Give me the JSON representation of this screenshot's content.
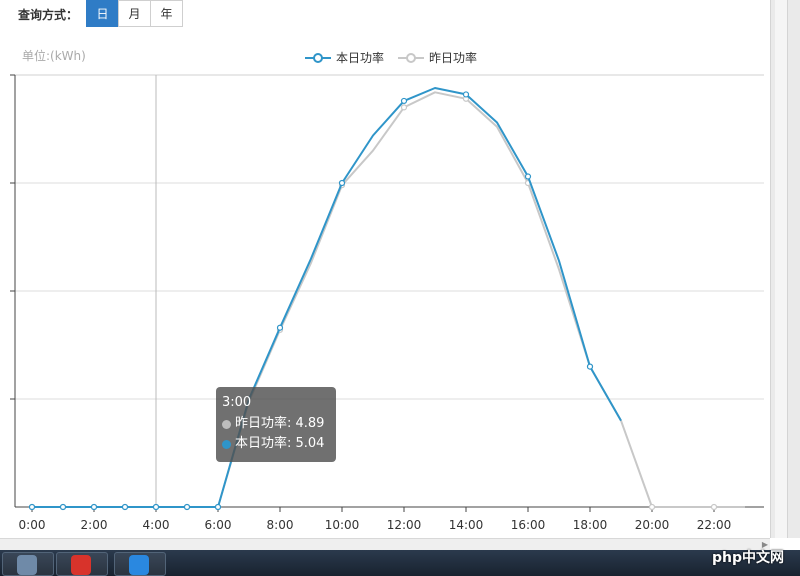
{
  "toolbar": {
    "query_label": "查询方式：",
    "buttons": [
      "日",
      "月",
      "年"
    ],
    "active": "日"
  },
  "chart_data": {
    "type": "line",
    "unit_label": "单位:(kWh)",
    "x_ticks": [
      "0:00",
      "2:00",
      "4:00",
      "6:00",
      "8:00",
      "10:00",
      "12:00",
      "14:00",
      "16:00",
      "18:00",
      "20:00",
      "22:00"
    ],
    "x": [
      0,
      1,
      2,
      3,
      4,
      5,
      6,
      7,
      8,
      9,
      10,
      11,
      12,
      13,
      14,
      15,
      16,
      17,
      18,
      19,
      20,
      21,
      22,
      23
    ],
    "ylim": [
      0,
      20
    ],
    "y_gridlines": [
      5,
      10,
      15
    ],
    "series": [
      {
        "name": "本日功率",
        "color": "#2f95c9",
        "values": [
          0,
          0,
          0,
          0,
          0,
          0,
          0,
          5,
          8.3,
          11.5,
          15,
          17.2,
          18.8,
          19.4,
          19.1,
          17.8,
          15.3,
          11.4,
          6.5,
          4.0,
          null,
          null,
          null,
          null
        ]
      },
      {
        "name": "昨日功率",
        "color": "#c8c8c8",
        "values": [
          0,
          0,
          0,
          0,
          0,
          0,
          0,
          4.89,
          8.2,
          11.3,
          14.9,
          16.5,
          18.5,
          19.2,
          18.9,
          17.6,
          15.0,
          11.0,
          6.5,
          4.0,
          0,
          0,
          0,
          0
        ]
      }
    ],
    "tooltip": {
      "title": "3:00",
      "rows": [
        {
          "label": "昨日功率: 4.89",
          "color": "#bdbdbd"
        },
        {
          "label": "本日功率: 5.04",
          "color": "#2f95c9"
        }
      ]
    }
  },
  "taskbar": {
    "watermark": "php中文网"
  }
}
